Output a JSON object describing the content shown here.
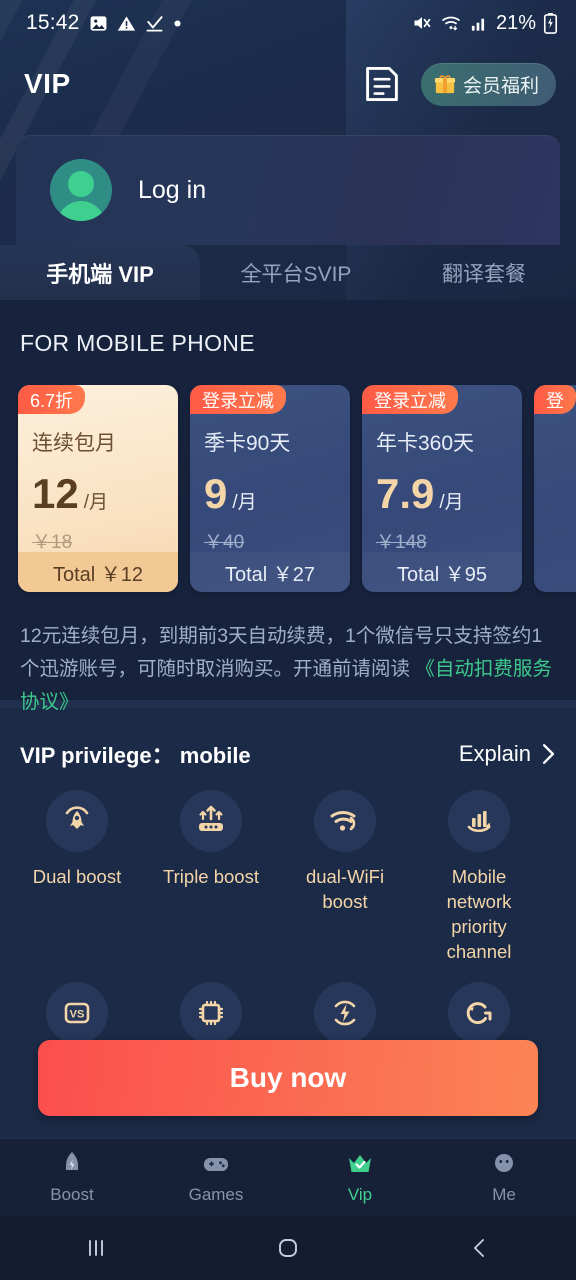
{
  "status_bar": {
    "time": "15:42",
    "battery_percent": "21%",
    "icons": [
      "image-icon",
      "warning-icon",
      "download-complete-icon",
      "dot-icon",
      "mute-icon",
      "wifi-icon",
      "signal-icon",
      "battery-charging-icon"
    ]
  },
  "header": {
    "title": "VIP",
    "order_icon": "order-document-icon",
    "gift_badge": {
      "icon": "gift-icon",
      "label": "会员福利"
    }
  },
  "login_card": {
    "label": "Log in",
    "avatar_icon": "user-avatar-icon"
  },
  "tabs": [
    {
      "label": "手机端 VIP",
      "active": true
    },
    {
      "label": "全平台SVIP",
      "active": false
    },
    {
      "label": "翻译套餐",
      "active": false
    }
  ],
  "plans_section": {
    "title": "FOR MOBILE PHONE",
    "plans": [
      {
        "badge": "6.7折",
        "name": "连续包月",
        "price": "12",
        "per": "/月",
        "old_price": "￥18",
        "total": "Total ￥12",
        "selected": true
      },
      {
        "badge": "登录立减",
        "name": "季卡90天",
        "price": "9",
        "per": "/月",
        "old_price": "￥40",
        "total": "Total ￥27",
        "selected": false
      },
      {
        "badge": "登录立减",
        "name": "年卡360天",
        "price": "7.9",
        "per": "/月",
        "old_price": "￥148",
        "total": "Total ￥95",
        "selected": false
      },
      {
        "badge": "登",
        "name": "",
        "price": "",
        "per": "",
        "old_price": "",
        "total": "",
        "selected": false
      }
    ]
  },
  "disclaimer": {
    "text": "12元连续包月，到期前3天自动续费，1个微信号只支持签约1个迅游账号，可随时取消购买。开通前请阅读 ",
    "link": "《自动扣费服务协议》"
  },
  "privilege": {
    "title": "VIP privilege： mobile",
    "explain": "Explain",
    "chevron_icon": "chevron-right-icon",
    "items": [
      {
        "label": "Dual boost",
        "icon": "rocket-boost-icon"
      },
      {
        "label": "Triple boost",
        "icon": "router-arrows-icon"
      },
      {
        "label": "dual-WiFi boost",
        "icon": "wifi-boost-icon"
      },
      {
        "label": "Mobile network priority channel",
        "icon": "signal-bars-arrow-icon"
      },
      {
        "label": "",
        "icon": "versus-icon"
      },
      {
        "label": "",
        "icon": "chip-icon"
      },
      {
        "label": "",
        "icon": "lightning-icon"
      },
      {
        "label": "",
        "icon": "g-accelerate-icon"
      }
    ]
  },
  "buy_button": {
    "label": "Buy now"
  },
  "bottom_nav": [
    {
      "label": "Boost",
      "icon": "rocket-icon",
      "active": false
    },
    {
      "label": "Games",
      "icon": "gamepad-icon",
      "active": false
    },
    {
      "label": "Vip",
      "icon": "crown-icon",
      "active": true
    },
    {
      "label": "Me",
      "icon": "person-icon",
      "active": false
    }
  ],
  "system_nav": [
    {
      "icon": "recents-icon"
    },
    {
      "icon": "home-icon"
    },
    {
      "icon": "back-icon"
    }
  ],
  "colors": {
    "accent_green": "#3fd08f",
    "badge_red": "#ff5a45",
    "gold": "#f3d5a8",
    "bg": "#17233d"
  }
}
